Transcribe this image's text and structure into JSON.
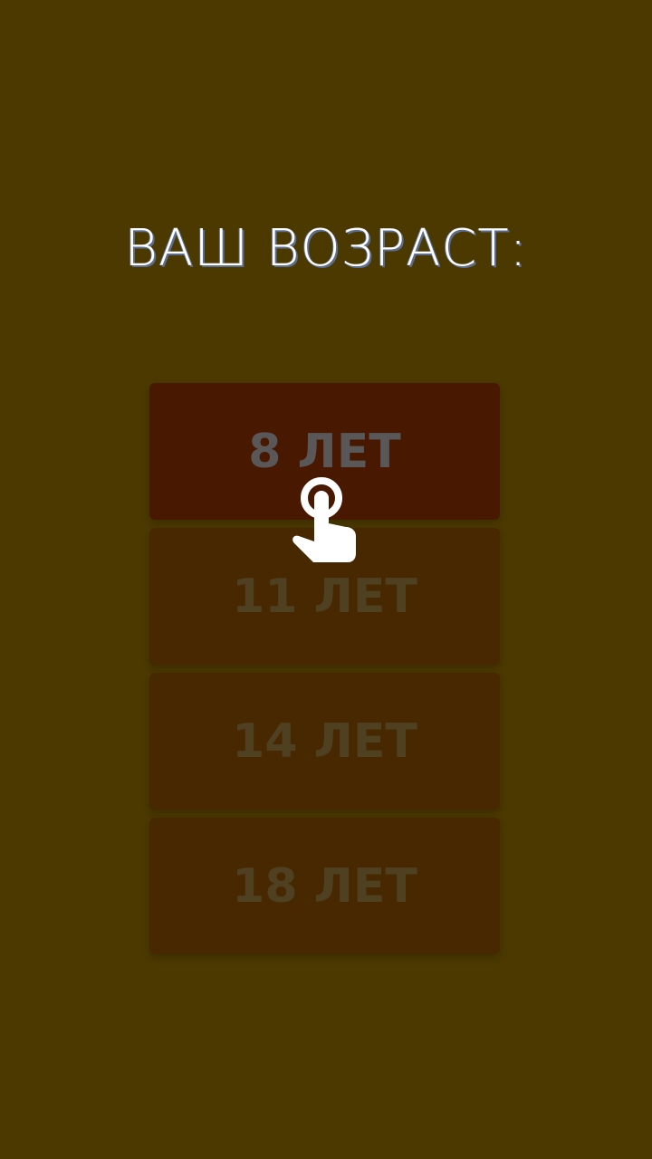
{
  "header": {
    "title": "ВАШ ВОЗРАСТ:"
  },
  "options": [
    {
      "label": "8 ЛЕТ",
      "state": "selected"
    },
    {
      "label": "11 ЛЕТ",
      "state": "dim"
    },
    {
      "label": "14 ЛЕТ",
      "state": "dim"
    },
    {
      "label": "18 ЛЕТ",
      "state": "dim"
    }
  ],
  "icons": {
    "tap_hint": "tap-hand-icon"
  },
  "colors": {
    "background": "#4b3900",
    "selected_button": "#481800",
    "button": "#472800",
    "title_text": "#ffffff"
  }
}
